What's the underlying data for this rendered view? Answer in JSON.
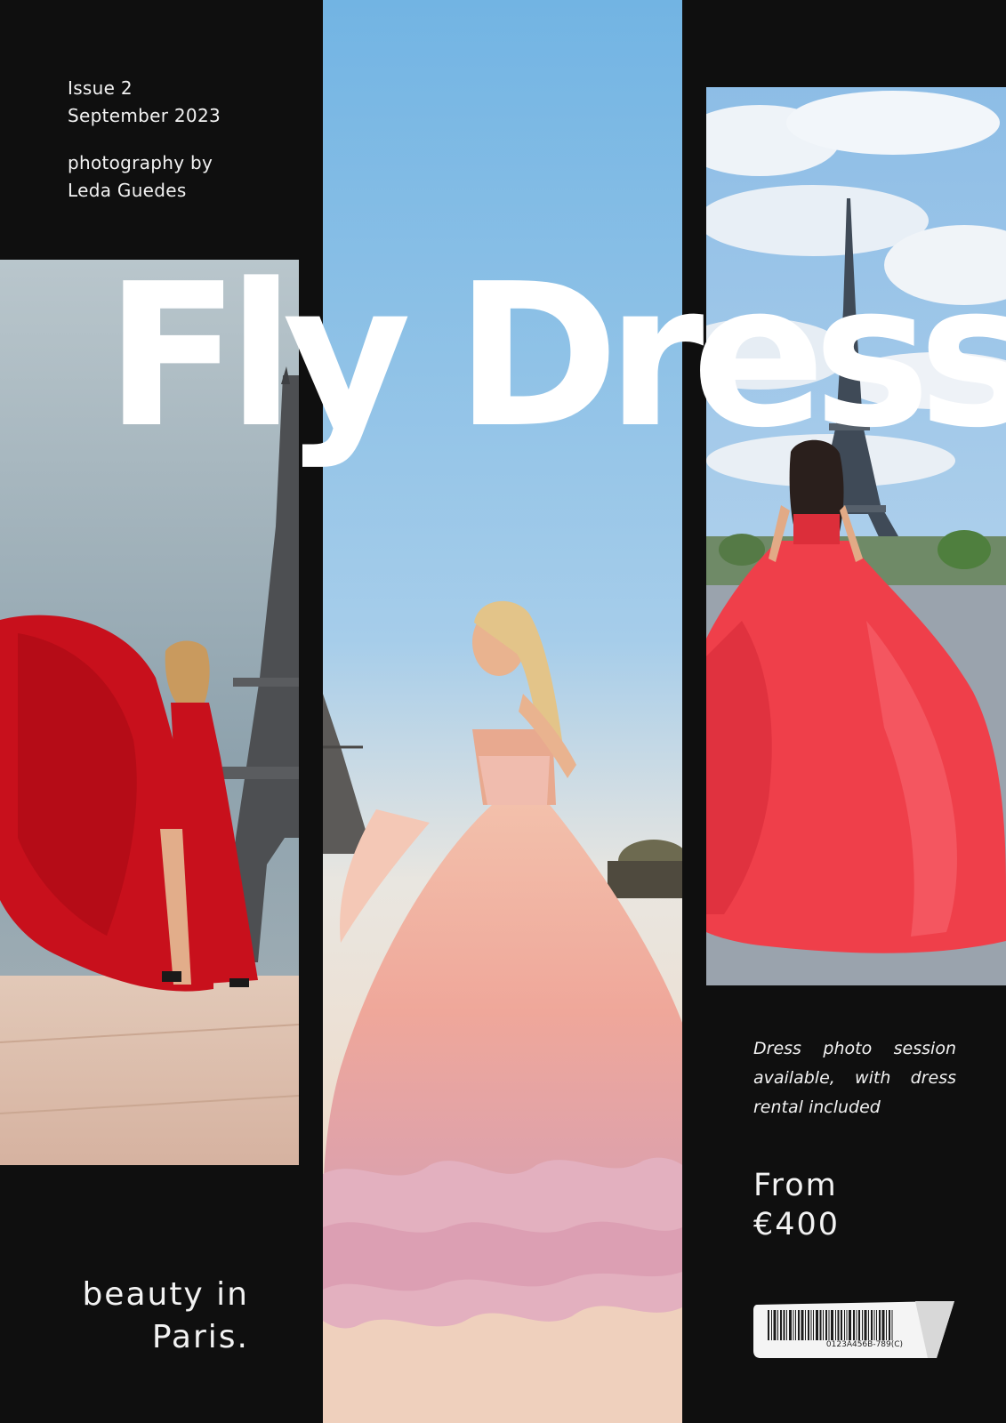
{
  "issue": {
    "number": "Issue 2",
    "date": "September 2023"
  },
  "credit": {
    "line1": "photography by",
    "line2": "Leda Guedes"
  },
  "masthead": {
    "title": "Fly Dress"
  },
  "promo": {
    "text": "Dress photo session available, with dress rental included"
  },
  "price": {
    "label": "From",
    "value": "€400"
  },
  "tagline": {
    "line1": "beauty in",
    "line2": "Paris."
  },
  "barcode": {
    "number": "0123A456B-789(C)"
  },
  "colors": {
    "background": "#0f0f0f",
    "text": "#f2f2f2",
    "red_dress": "#c8101c",
    "pink_dress": "#f1b1a4",
    "coral_dress": "#ef3f4a",
    "sky_blue": "#7ab8e6"
  }
}
